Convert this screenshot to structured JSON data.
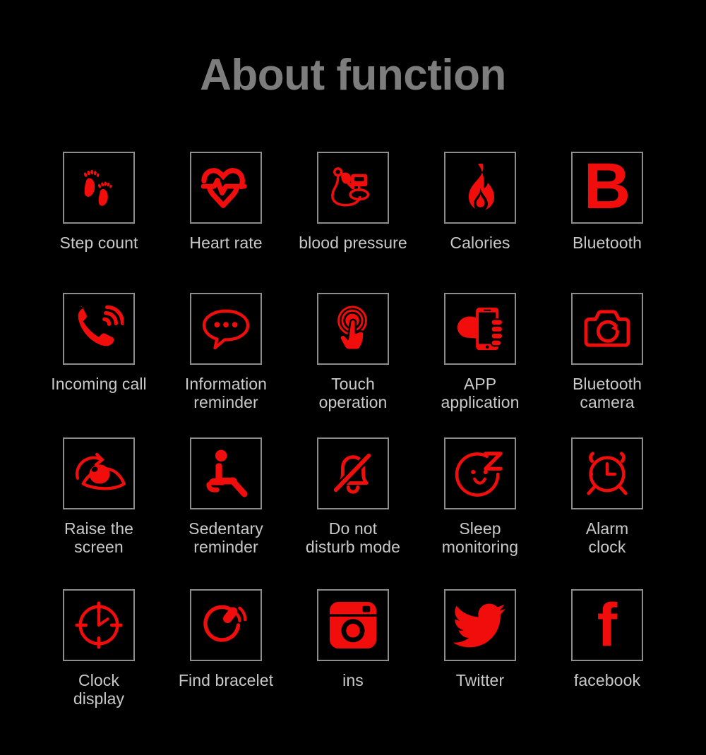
{
  "page": {
    "title": "About function",
    "background_color": "#000000",
    "title_color": "#7d7d7d",
    "accent_color": "#f20d0d",
    "label_color": "#c9c9c9",
    "box_border_color": "#8c8c8c"
  },
  "grid": {
    "columns": 5,
    "rows": 4,
    "items": [
      {
        "label": "Step count",
        "icon": "footprints-icon"
      },
      {
        "label": "Heart rate",
        "icon": "heart-pulse-icon"
      },
      {
        "label": "blood pressure",
        "icon": "blood-pressure-monitor-icon"
      },
      {
        "label": "Calories",
        "icon": "flame-icon"
      },
      {
        "label": "Bluetooth",
        "icon": "letter-b-icon"
      },
      {
        "label": "Incoming call",
        "icon": "ringing-phone-icon"
      },
      {
        "label": "Information\nreminder",
        "icon": "speech-bubble-icon"
      },
      {
        "label": "Touch\noperation",
        "icon": "touch-finger-icon"
      },
      {
        "label": "APP\napplication",
        "icon": "hand-holding-phone-icon"
      },
      {
        "label": "Bluetooth\ncamera",
        "icon": "camera-outline-icon"
      },
      {
        "label": "Raise the\nscreen",
        "icon": "eye-rotate-icon"
      },
      {
        "label": "Sedentary\nreminder",
        "icon": "seated-person-icon"
      },
      {
        "label": "Do not\ndisturb mode",
        "icon": "bell-slash-icon"
      },
      {
        "label": "Sleep\nmonitoring",
        "icon": "sleeping-face-icon"
      },
      {
        "label": "Alarm\nclock",
        "icon": "alarm-clock-icon"
      },
      {
        "label": "Clock\ndisplay",
        "icon": "clock-face-icon"
      },
      {
        "label": "Find bracelet",
        "icon": "vibrating-bracelet-icon"
      },
      {
        "label": "ins",
        "icon": "instagram-icon"
      },
      {
        "label": "Twitter",
        "icon": "twitter-bird-icon"
      },
      {
        "label": "facebook",
        "icon": "facebook-f-icon"
      }
    ]
  }
}
